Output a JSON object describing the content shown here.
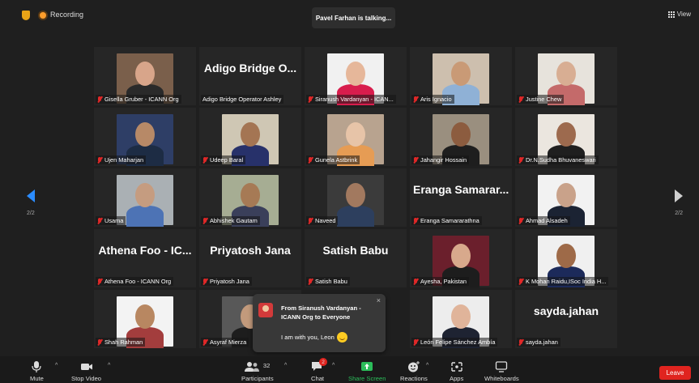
{
  "topbar": {
    "recording_label": "Recording",
    "talking": "Pavel Farhan is talking...",
    "view_label": "View"
  },
  "pagination": {
    "left": "2/2",
    "right": "2/2"
  },
  "tiles": [
    {
      "name": "Gisella Gruber - ICANN Org",
      "muted": true,
      "video": true,
      "bg": "#7a5f4b",
      "skin": "#d8a58a",
      "shirt": "#2a2a2a"
    },
    {
      "name": "Adigo Bridge Operator Ashley",
      "display": "Adigo Bridge O...",
      "muted": false,
      "video": false
    },
    {
      "name": "Siranush Vardanyan - ICAN...",
      "muted": true,
      "video": true,
      "bg": "#f1f1f1",
      "skin": "#e6b79a",
      "shirt": "#d81d4d"
    },
    {
      "name": "Aris Ignacio",
      "muted": true,
      "video": true,
      "bg": "#cdbfae",
      "skin": "#c99a76",
      "shirt": "#8fb1d6"
    },
    {
      "name": "Justine Chew",
      "muted": true,
      "video": true,
      "bg": "#e7e3dc",
      "skin": "#d8ae93",
      "shirt": "#c46a6a"
    },
    {
      "name": "Ujen Maharjan",
      "muted": true,
      "video": true,
      "bg": "#2e3e66",
      "skin": "#b78967",
      "shirt": "#1d2c44"
    },
    {
      "name": "Udeep Baral",
      "muted": true,
      "video": true,
      "bg": "#cfc7b4",
      "skin": "#a47553",
      "shirt": "#27316a"
    },
    {
      "name": "Gunela Astbrink",
      "muted": true,
      "video": true,
      "bg": "#b8a38f",
      "skin": "#e7c4a8",
      "shirt": "#e69c54"
    },
    {
      "name": "Jahangir Hossain",
      "muted": true,
      "video": true,
      "bg": "#9a8f7f",
      "skin": "#8c5c3f",
      "shirt": "#1e1e1e"
    },
    {
      "name": "Dr.N.Sudha Bhuvaneswari",
      "muted": true,
      "video": true,
      "bg": "#ebe6df",
      "skin": "#9d6a4e",
      "shirt": "#1f1f1f"
    },
    {
      "name": "Usama",
      "muted": true,
      "video": true,
      "bg": "#aab0b4",
      "skin": "#c59c80",
      "shirt": "#4d73b5"
    },
    {
      "name": "Abhishek Gautam",
      "muted": true,
      "video": true,
      "bg": "#a6ad93",
      "skin": "#a67a55",
      "shirt": "#3a3f5a"
    },
    {
      "name": "Naveed",
      "muted": true,
      "video": true,
      "bg": "#3b3b3b",
      "skin": "#a2795f",
      "shirt": "#2d3f5e"
    },
    {
      "name": "Eranga Samararathna",
      "display": "Eranga Samarar...",
      "muted": true,
      "video": false
    },
    {
      "name": "Ahmad Alsadeh",
      "muted": true,
      "video": true,
      "bg": "#f2f2f2",
      "skin": "#c9a28a",
      "shirt": "#1b2333"
    },
    {
      "name": "Athena Foo - ICANN Org",
      "display": "Athena Foo - IC...",
      "muted": true,
      "video": false
    },
    {
      "name": "Priyatosh Jana",
      "display": "Priyatosh Jana",
      "muted": true,
      "video": false
    },
    {
      "name": "Satish Babu",
      "display": "Satish Babu",
      "muted": true,
      "video": false
    },
    {
      "name": "Ayesha, Pakistan",
      "muted": true,
      "video": true,
      "bg": "#6b1f2c",
      "skin": "#d8a98c",
      "shirt": "#1d1d1d"
    },
    {
      "name": "K Mohan Raidu,ISoc India H...",
      "muted": true,
      "video": true,
      "bg": "#f0f0f0",
      "skin": "#9e6a48",
      "shirt": "#1c2a5a"
    },
    {
      "name": "Shah Rahman",
      "muted": true,
      "video": true,
      "bg": "#f3f3f3",
      "skin": "#b88761",
      "shirt": "#a33d3d"
    },
    {
      "name": "Asyraf Mierza",
      "muted": true,
      "video": true,
      "bg": "#585858",
      "skin": "#c29a7c",
      "shirt": "#1d1d1d"
    },
    {
      "name": "",
      "muted": false,
      "video": false,
      "empty": true
    },
    {
      "name": "León Felipe Sánchez Ambía",
      "muted": true,
      "video": true,
      "bg": "#ededed",
      "skin": "#e0b49a",
      "shirt": "#1e2332"
    },
    {
      "name": "sayda.jahan",
      "display": "sayda.jahan",
      "muted": true,
      "video": false
    }
  ],
  "toast": {
    "from": "From Siranush Vardanyan - ICANN Org to Everyone",
    "message": "I am with you, Leon",
    "close": "×"
  },
  "toolbar": {
    "mute": "Mute",
    "stop_video": "Stop Video",
    "participants": "Participants",
    "participants_count": "32",
    "chat": "Chat",
    "chat_badge": "2",
    "share": "Share Screen",
    "reactions": "Reactions",
    "apps": "Apps",
    "whiteboards": "Whiteboards",
    "leave": "Leave"
  },
  "colors": {
    "accent_blue": "#2b8cff",
    "share_green": "#2bbd5a",
    "leave_red": "#e0241f",
    "muted_red": "#e02828"
  }
}
